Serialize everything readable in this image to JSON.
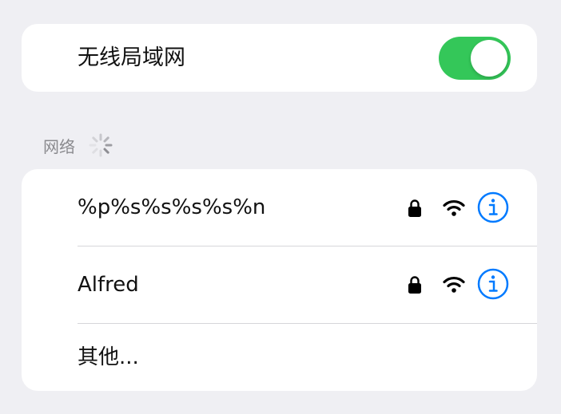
{
  "wifi": {
    "label": "无线局域网",
    "enabled": true,
    "toggle_color": "#34c759"
  },
  "networks_section": {
    "header": "网络",
    "spinner_icon": "loading-spinner-icon"
  },
  "networks": [
    {
      "name": "%p%s%s%s%s%n",
      "secured": true,
      "icons": [
        "lock-icon",
        "wifi-signal-icon",
        "info-icon"
      ]
    },
    {
      "name": "Alfred",
      "secured": true,
      "icons": [
        "lock-icon",
        "wifi-signal-icon",
        "info-icon"
      ]
    }
  ],
  "other_network": {
    "label": "其他..."
  },
  "colors": {
    "background": "#efeff3",
    "card": "#ffffff",
    "accent_blue": "#007aff",
    "secondary_text": "#8a8a8e"
  }
}
